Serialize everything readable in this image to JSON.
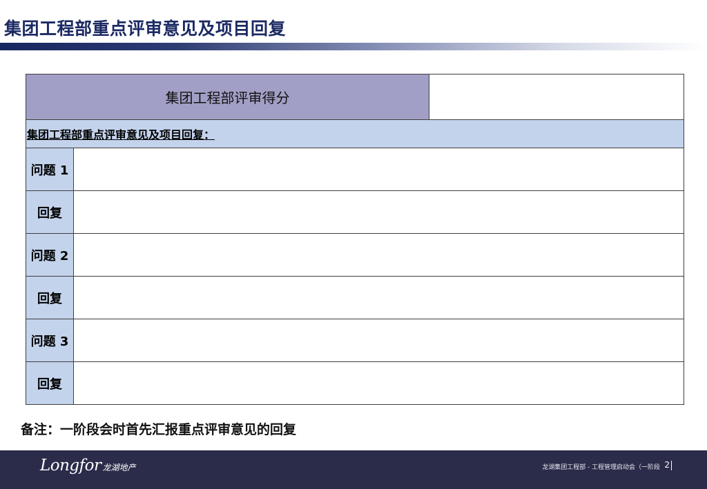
{
  "header": {
    "title": "集团工程部重点评审意见及项目回复"
  },
  "table": {
    "score_label": "集团工程部评审得分",
    "score_value": "",
    "section_heading": "集团工程部重点评审意见及项目回复：",
    "rows": [
      {
        "label": "问题 1",
        "content": ""
      },
      {
        "label": "回复",
        "content": ""
      },
      {
        "label": "问题 2",
        "content": ""
      },
      {
        "label": "回复",
        "content": ""
      },
      {
        "label": "问题 3",
        "content": ""
      },
      {
        "label": "回复",
        "content": ""
      }
    ]
  },
  "note": "备注：一阶段会时首先汇报重点评审意见的回复",
  "footer": {
    "logo_text": "Longfor",
    "logo_cn": "龙湖地产",
    "caption": "龙湖集团工程部 - 工程管理启动会（一阶段",
    "page_number": "2"
  },
  "colors": {
    "title": "#1c2a63",
    "score_header_bg": "#a19fc5",
    "label_bg": "#c3d3ec",
    "footer_bg": "#2b2b4a"
  }
}
